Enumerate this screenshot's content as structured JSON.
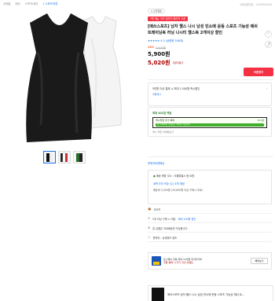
{
  "breadcrumbs": [
    "쿠팡홈",
    "패션",
    "스포츠/레저",
    "1 스포츠의류"
  ],
  "product_no": "쿠팡상품번호 : 3109954290",
  "seller_badge": "스타일랑",
  "promo_badge": "7월 메뉴 잇츠 온라인 패키지 쿠폰",
  "title": "[매쓰스포츠] 남자 헬스 나시 남성 민소매 운동 스포츠 기능성 메쉬 트레이닝복 러닝 나시티 헬스복 2개이상 할인",
  "rating": {
    "stars": "★★★★★",
    "count": "4.5 (상품평 308개)"
  },
  "discount": {
    "pct": "14%",
    "original": "5,900원"
  },
  "price_sale": "5,900원",
  "price_coupon": "5,020원",
  "coupon_label": "쿠폰적용가",
  "coupon_button": "쿠폰받기",
  "card_a": {
    "line1": "5만원 이상 결제 시 최대 1,500원 즉시할인",
    "line2": "쿠팡캐시"
  },
  "card_b": {
    "line1": "최대 401원 적립",
    "bar_text": "캐시적립 추가 혜택",
    "bar_count": "201원",
    "fill_text": "월 2,900원 가입하고 401원 적립하기",
    "line3": "캐시 적립 자세히보기"
  },
  "delivery_header": "판매자로켓배송",
  "delivery": {
    "line1": "배송 희망 주소 : 서울특별시",
    "line1_bold": "동 요청",
    "line2": "새벽 도착 보장 (수) 도착 예정",
    "line3": "배송비 3,000원 (19,800원 이상 구매시 무료)"
  },
  "rows": [
    {
      "icon": "📦",
      "text": "사이즈",
      "extra": ""
    },
    {
      "icon": "↻",
      "text": "2개 이상 구매 시 개당",
      "extra": "최대 100원 할인"
    },
    {
      "icon": "⚙",
      "text": "본 상품은 국내배송만 가능합니다.",
      "extra": ""
    },
    {
      "icon": "ⓘ",
      "text": "판매자 : 상세정보 참조",
      "extra": ""
    }
  ],
  "card_c": {
    "line1": "토스페이 쿠팡 최대 12개월 무이자할부",
    "line2": "쿠팡 결제 시 추가 할인 이벤트",
    "button": "혜택보기"
  },
  "bottom_title": "매쓰스포츠 남자 헬스 나시 남성 민소매 운동 스포츠 기능성 메쉬 트..."
}
